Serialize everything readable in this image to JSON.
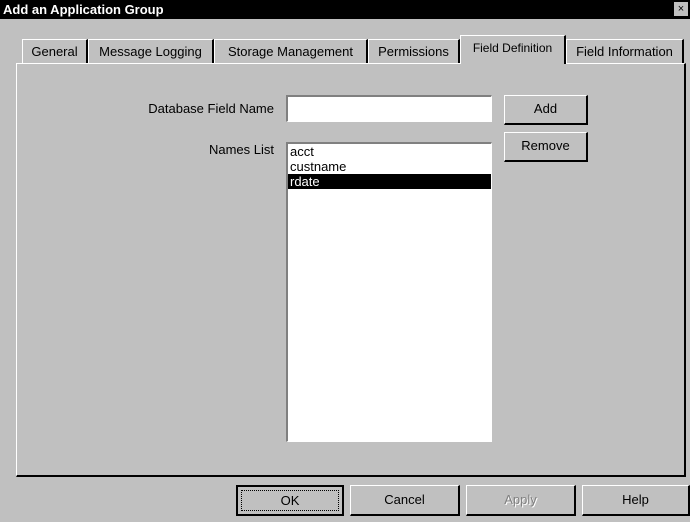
{
  "window": {
    "title": "Add an Application Group",
    "close_glyph": "×"
  },
  "tabs": [
    {
      "label": "General"
    },
    {
      "label": "Message Logging"
    },
    {
      "label": "Storage Management"
    },
    {
      "label": "Permissions"
    },
    {
      "label": "Field Definition",
      "active": true
    },
    {
      "label": "Field Information"
    }
  ],
  "form": {
    "db_field_label": "Database Field Name",
    "db_field_value": "",
    "names_list_label": "Names List",
    "names": [
      {
        "text": "acct",
        "selected": false
      },
      {
        "text": "custname",
        "selected": false
      },
      {
        "text": "rdate",
        "selected": true
      }
    ],
    "add_label": "Add",
    "remove_label": "Remove"
  },
  "footer": {
    "ok_label": "OK",
    "cancel_label": "Cancel",
    "apply_label": "Apply",
    "help_label": "Help"
  }
}
